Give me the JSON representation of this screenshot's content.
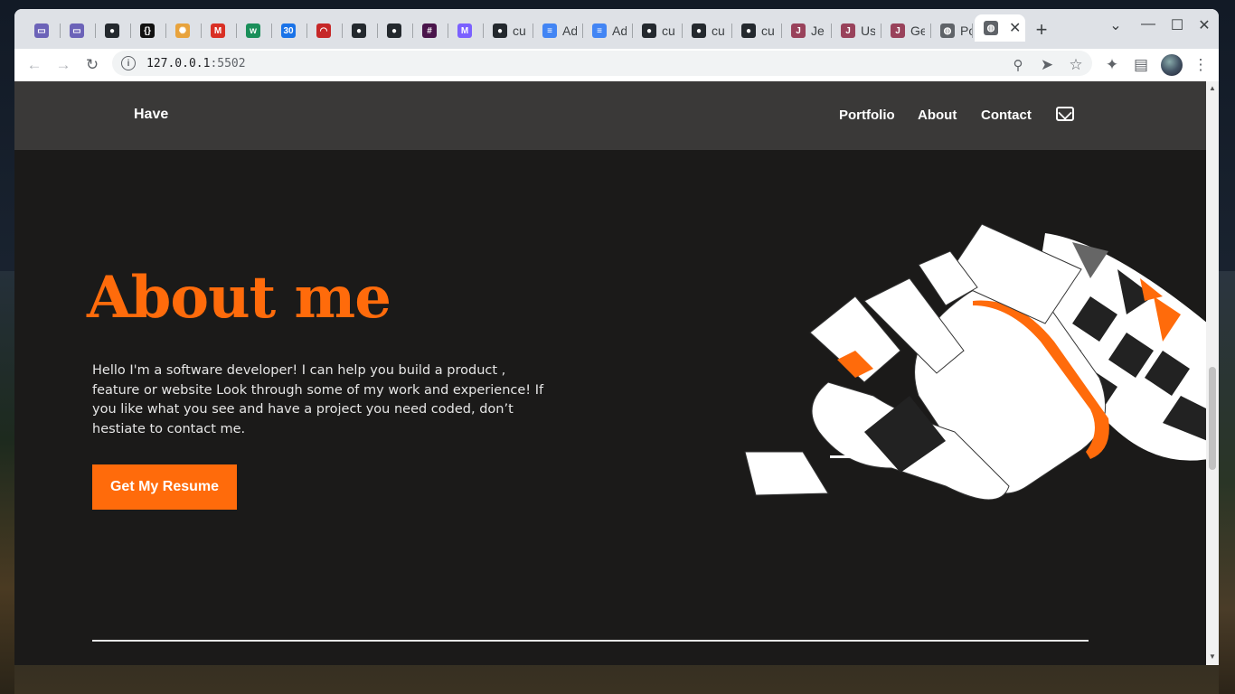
{
  "tabs": [
    {
      "label": "",
      "icon": "wallet-icon"
    },
    {
      "label": "",
      "icon": "wallet-icon"
    },
    {
      "label": "",
      "icon": "github-icon"
    },
    {
      "label": "",
      "icon": "code-icon"
    },
    {
      "label": "",
      "icon": "dots-icon"
    },
    {
      "label": "",
      "icon": "gmail-icon"
    },
    {
      "label": "",
      "icon": "w-icon"
    },
    {
      "label": "",
      "icon": "calendar-icon"
    },
    {
      "label": "",
      "icon": "gauge-icon"
    },
    {
      "label": "",
      "icon": "github-icon"
    },
    {
      "label": "",
      "icon": "github-icon"
    },
    {
      "label": "",
      "icon": "slack-icon"
    },
    {
      "label": "",
      "icon": "m-icon"
    },
    {
      "label": "cu",
      "icon": "github-icon"
    },
    {
      "label": "Ad",
      "icon": "docs-icon"
    },
    {
      "label": "Ad",
      "icon": "docs-icon"
    },
    {
      "label": "cu",
      "icon": "github-icon"
    },
    {
      "label": "cu",
      "icon": "github-icon"
    },
    {
      "label": "cu",
      "icon": "github-icon"
    },
    {
      "label": "Je",
      "icon": "jest-icon"
    },
    {
      "label": "Us",
      "icon": "jest-icon"
    },
    {
      "label": "Ge",
      "icon": "jest-icon"
    },
    {
      "label": "Po",
      "icon": "globe-icon"
    }
  ],
  "active_tab": {
    "label": "",
    "icon": "globe-icon"
  },
  "address_bar": {
    "host": "127.0.0.1",
    "port": ":5502"
  },
  "site": {
    "logo": "Have",
    "nav": [
      "Portfolio",
      "About",
      "Contact"
    ]
  },
  "hero": {
    "title": "About me",
    "body": "Hello I'm a software developer! I can help you build a product , feature or website Look through some of my work and experience! If you like what you see and have a project you need coded, don’t hestiate to contact me.",
    "button": "Get My Resume"
  },
  "colors": {
    "accent": "#ff6b0b",
    "page_bg": "#1b1a19",
    "header_bg": "#3a3938"
  }
}
